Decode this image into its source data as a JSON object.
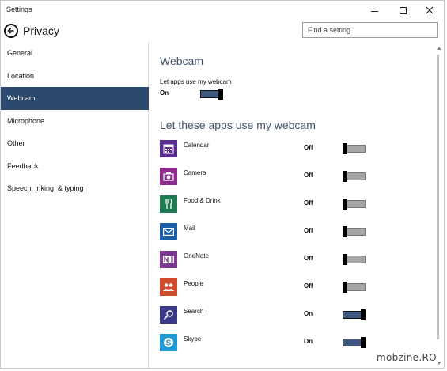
{
  "window": {
    "title": "Settings"
  },
  "header": {
    "title": "Privacy",
    "search_placeholder": "Find a setting"
  },
  "sidebar": {
    "items": [
      {
        "label": "General",
        "active": false
      },
      {
        "label": "Location",
        "active": false
      },
      {
        "label": "Webcam",
        "active": true
      },
      {
        "label": "Microphone",
        "active": false
      },
      {
        "label": "Other",
        "active": false
      },
      {
        "label": "Feedback",
        "active": false
      },
      {
        "label": "Speech, inking, & typing",
        "active": false
      }
    ]
  },
  "main": {
    "section_title": "Webcam",
    "master_label": "Let apps use my webcam",
    "master_state": "On",
    "apps_heading": "Let these apps use my webcam",
    "apps": [
      {
        "name": "Calendar",
        "state": "Off",
        "icon": "calendar-icon",
        "color": "#5b2d8e"
      },
      {
        "name": "Camera",
        "state": "Off",
        "icon": "camera-icon",
        "color": "#8e2c8d"
      },
      {
        "name": "Food & Drink",
        "state": "Off",
        "icon": "food-drink-icon",
        "color": "#1f7a54"
      },
      {
        "name": "Mail",
        "state": "Off",
        "icon": "mail-icon",
        "color": "#1c5ea8"
      },
      {
        "name": "OneNote",
        "state": "Off",
        "icon": "onenote-icon",
        "color": "#7a3b8f"
      },
      {
        "name": "People",
        "state": "Off",
        "icon": "people-icon",
        "color": "#d04a2c"
      },
      {
        "name": "Search",
        "state": "On",
        "icon": "search-icon",
        "color": "#3a3a8a"
      },
      {
        "name": "Skype",
        "state": "On",
        "icon": "skype-icon",
        "color": "#1e9ad6"
      }
    ]
  },
  "colors": {
    "accent": "#2c4a6f",
    "toggle_on": "#3e5880",
    "toggle_off": "#a6a6a6",
    "heading": "#44536a"
  },
  "watermark": "mobzine.RO"
}
